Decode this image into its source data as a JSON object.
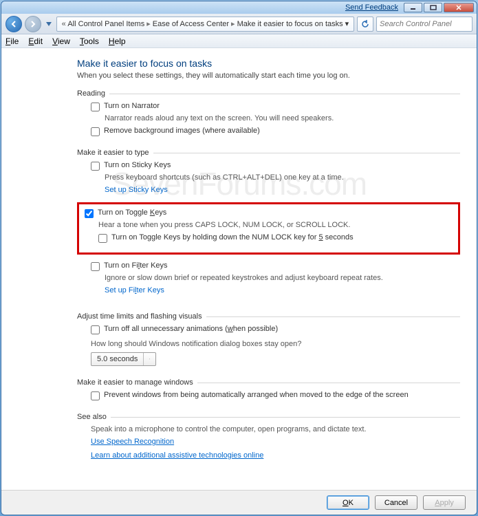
{
  "titlebar": {
    "feedback": "Send Feedback"
  },
  "breadcrumbs": {
    "a": "All Control Panel Items",
    "b": "Ease of Access Center",
    "c": "Make it easier to focus on tasks"
  },
  "search": {
    "placeholder": "Search Control Panel"
  },
  "menu": {
    "file": "File",
    "edit": "Edit",
    "view": "View",
    "tools": "Tools",
    "help": "Help"
  },
  "page": {
    "title": "Make it easier to focus on tasks",
    "subtitle": "When you select these settings, they will automatically start each time you log on."
  },
  "reading": {
    "head": "Reading",
    "narrator_label": "Turn on Narrator",
    "narrator_desc": "Narrator reads aloud any text on the screen. You will need speakers.",
    "removebg_label": "Remove background images (where available)"
  },
  "typing": {
    "head": "Make it easier to type",
    "sticky_label": "Turn on Sticky Keys",
    "sticky_desc": "Press keyboard shortcuts (such as CTRL+ALT+DEL) one key at a time.",
    "sticky_link": "Set up Sticky Keys",
    "toggle_label_pre": "Turn on Toggle ",
    "toggle_label_u": "K",
    "toggle_label_post": "eys",
    "toggle_desc": "Hear a tone when you press CAPS LOCK, NUM LOCK, or SCROLL LOCK.",
    "toggle_hold_pre": "Turn on Toggle Keys by holding down the NUM LOCK key for ",
    "toggle_hold_u": "5",
    "toggle_hold_post": " seconds",
    "filter_label_pre": "Turn on Fi",
    "filter_label_u": "l",
    "filter_label_post": "ter Keys",
    "filter_desc": "Ignore or slow down brief or repeated keystrokes and adjust keyboard repeat rates.",
    "filter_link_pre": "Set up Fi",
    "filter_link_u": "l",
    "filter_link_post": "ter Keys"
  },
  "visuals": {
    "head": "Adjust time limits and flashing visuals",
    "anim_pre": "Turn off all unnecessary animations (",
    "anim_u": "w",
    "anim_post": "hen possible)",
    "howlong": "How long should Windows notification dialog boxes stay open?",
    "duration": "5.0 seconds"
  },
  "windows": {
    "head": "Make it easier to manage windows",
    "prevent_label": "Prevent windows from being automatically arranged when moved to the edge of the screen"
  },
  "seealso": {
    "head": "See also",
    "desc": "Speak into a microphone to control the computer, open programs, and dictate text.",
    "speech": "Use Speech Recognition",
    "learn": "Learn about additional assistive technologies online"
  },
  "buttons": {
    "ok_u": "O",
    "ok_post": "K",
    "cancel": "Cancel",
    "apply_u": "A",
    "apply_post": "pply"
  },
  "watermark": "SevenForums.com"
}
